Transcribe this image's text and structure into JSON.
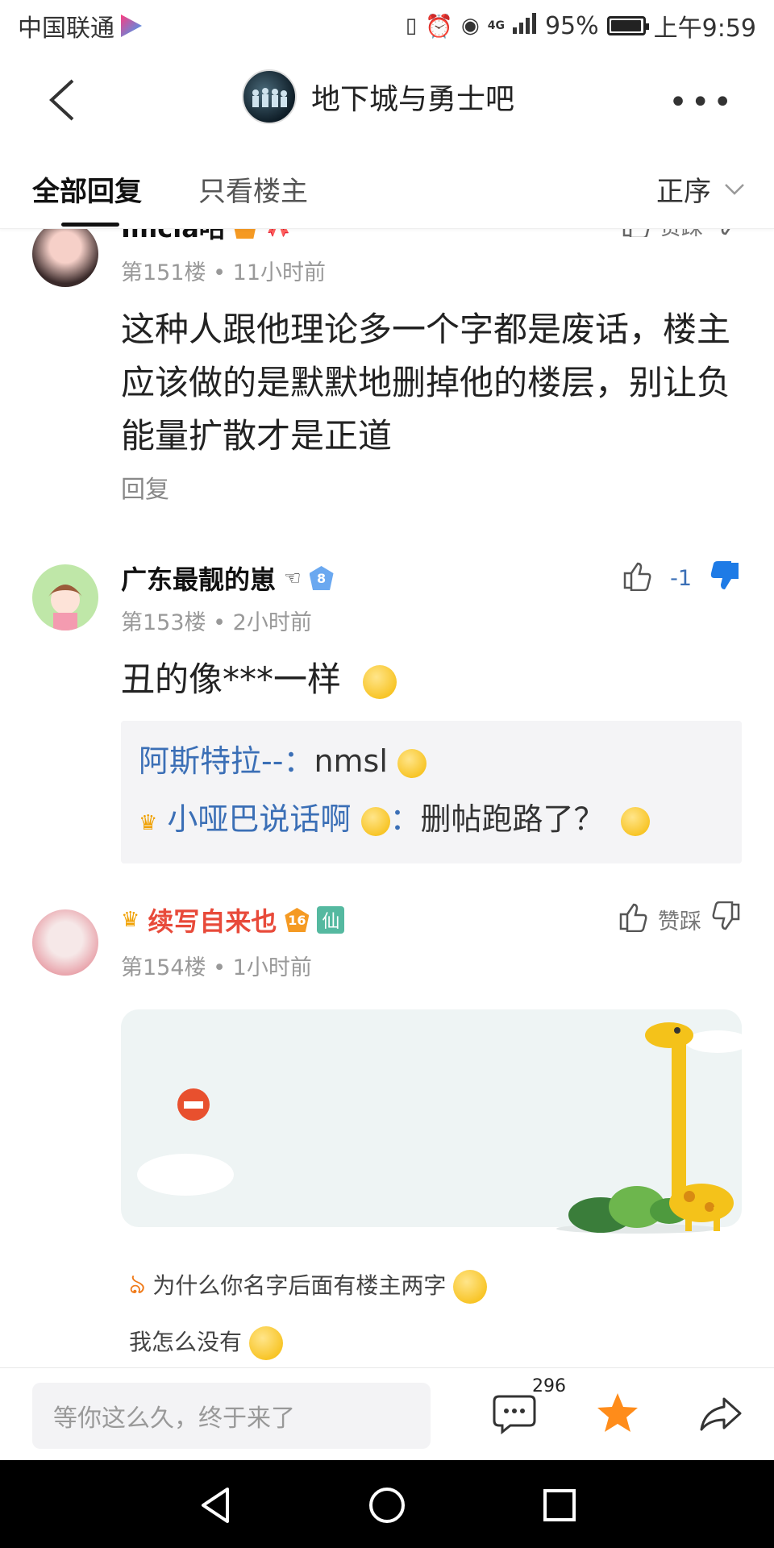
{
  "status_bar": {
    "carrier": "中国联通",
    "network": "4G",
    "battery": "95%",
    "time": "上午9:59"
  },
  "header": {
    "forum_name": "地下城与勇士吧"
  },
  "tabs": {
    "all_replies": "全部回复",
    "op_only": "只看楼主",
    "sort": "正序"
  },
  "posts": [
    {
      "username": "Imcia咕",
      "floor": "第151楼",
      "time": "11小时前",
      "content": "这种人跟他理论多一个字都是废话，楼主应该做的是默默地删掉他的楼层，别让负能量扩散才是正道",
      "reply_label": "回复",
      "like_label": "赞踩"
    },
    {
      "username": "广东最靓的崽",
      "level": "8",
      "floor": "第153楼",
      "time": "2小时前",
      "vote_count": "-1",
      "content": "丑的像***一样",
      "replies": [
        {
          "name": "阿斯特拉--",
          "sep": "：",
          "text": "nmsl"
        },
        {
          "name": "小哑巴说话啊",
          "sep": "：",
          "text": "删帖跑路了？"
        }
      ]
    },
    {
      "username": "续写自来也",
      "level": "16",
      "badge": "仙",
      "floor": "第154楼",
      "time": "1小时前",
      "like_label": "赞踩",
      "caption_line1": "为什么你名字后面有楼主两字",
      "caption_line2": "我怎么没有"
    }
  ],
  "meta_separator": "•",
  "bottom_bar": {
    "input_placeholder": "等你这么久，终于来了",
    "comment_count": "296"
  },
  "colors": {
    "accent_blue": "#3b6fb6",
    "thumb_down_blue": "#1e7be6",
    "username_red": "#e84a3a",
    "star": "#ff8c1a"
  }
}
